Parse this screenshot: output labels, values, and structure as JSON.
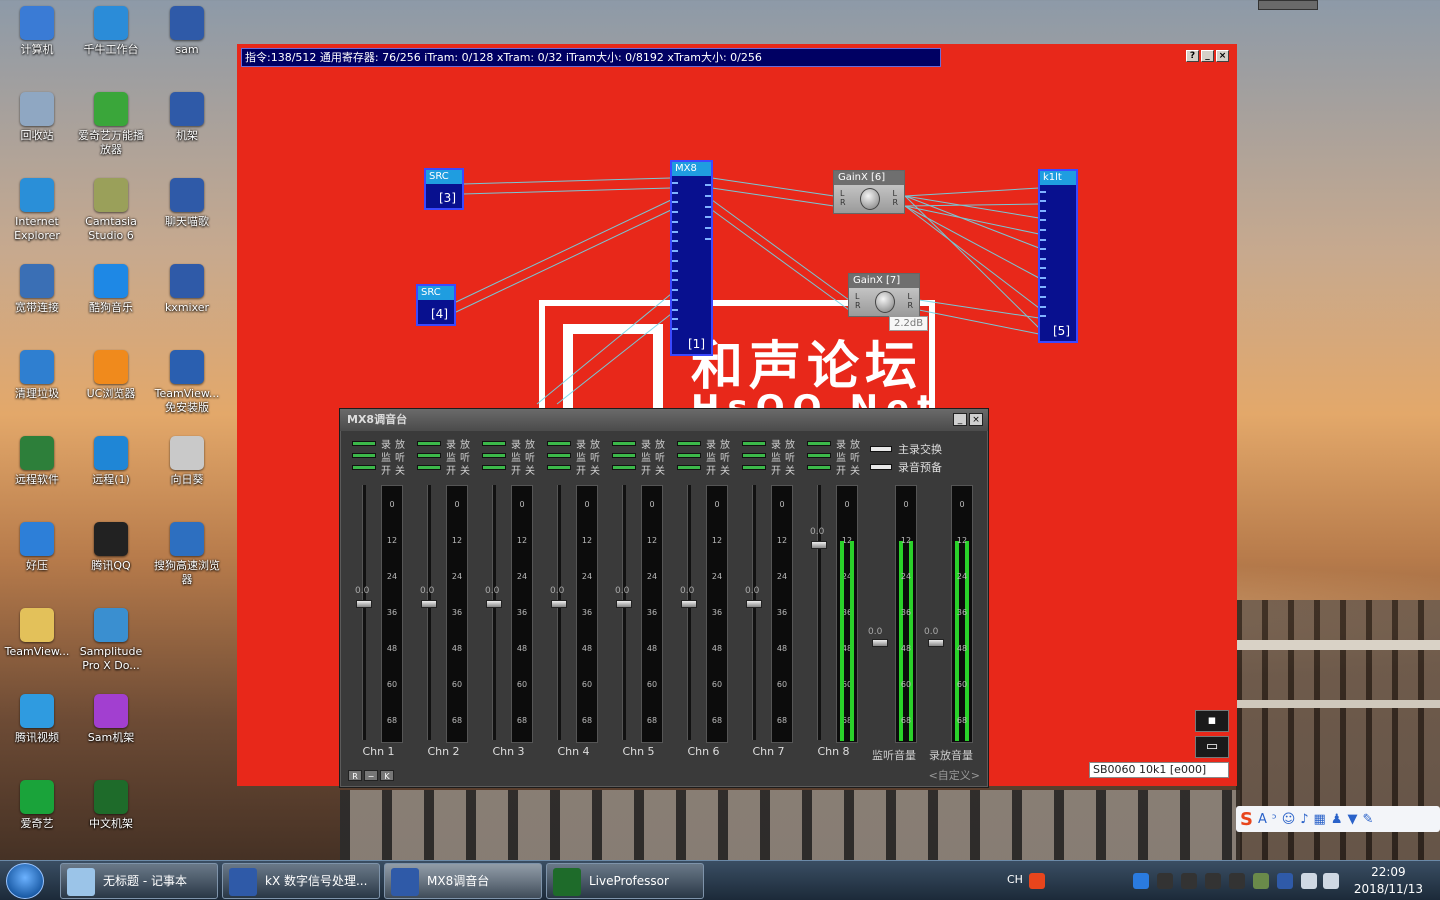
{
  "desktop": {
    "icons": [
      {
        "label": "计算机",
        "icon": "computer-icon",
        "color": "#3a7bd5"
      },
      {
        "label": "千牛工作台",
        "icon": "qianniu-icon",
        "color": "#2b8cd8"
      },
      {
        "label": "sam",
        "icon": "kx-icon",
        "color": "#2f5aa8"
      },
      {
        "label": "回收站",
        "icon": "recycle-bin-icon",
        "color": "#8fa7c2"
      },
      {
        "label": "爱奇艺万能播放器",
        "icon": "iqiyi-player-icon",
        "color": "#3aa63a"
      },
      {
        "label": "机架",
        "icon": "kx-icon",
        "color": "#2f5aa8"
      },
      {
        "label": "Internet Explorer",
        "icon": "ie-icon",
        "color": "#2a8fd8"
      },
      {
        "label": "Camtasia Studio 6",
        "icon": "camtasia-icon",
        "color": "#9aa05a"
      },
      {
        "label": "聊天喵歌",
        "icon": "kx-icon",
        "color": "#2f5aa8"
      },
      {
        "label": "宽带连接",
        "icon": "network-icon",
        "color": "#3a6fb5"
      },
      {
        "label": "酷狗音乐",
        "icon": "kugou-icon",
        "color": "#1e88e5"
      },
      {
        "label": "kxmixer",
        "icon": "kx-icon",
        "color": "#2f5aa8"
      },
      {
        "label": "清理垃圾",
        "icon": "cleaner-icon",
        "color": "#2f7fd0"
      },
      {
        "label": "UC浏览器",
        "icon": "uc-browser-icon",
        "color": "#f08a1c"
      },
      {
        "label": "TeamView...免安装版",
        "icon": "teamviewer-icon",
        "color": "#2a5fb0"
      },
      {
        "label": "远程软件",
        "icon": "folder-icon",
        "color": "#2d7f3a"
      },
      {
        "label": "远程(1)",
        "icon": "remote-icon",
        "color": "#1f86d6"
      },
      {
        "label": "向日葵",
        "icon": "document-icon",
        "color": "#c9c9c9"
      },
      {
        "label": "好压",
        "icon": "haozip-icon",
        "color": "#2d7fd8"
      },
      {
        "label": "腾讯QQ",
        "icon": "qq-icon",
        "color": "#222222"
      },
      {
        "label": "搜狗高速浏览器",
        "icon": "sogou-browser-icon",
        "color": "#2d6fc0"
      },
      {
        "label": "TeamView...",
        "icon": "folder-icon",
        "color": "#e3c15a"
      },
      {
        "label": "Samplitude Pro X Do...",
        "icon": "samplitude-icon",
        "color": "#3a8fd0"
      },
      {
        "label": "腾讯视频",
        "icon": "tencent-video-icon",
        "color": "#2f9be0"
      },
      {
        "label": "Sam机架",
        "icon": "sam-rack-icon",
        "color": "#a23fd0"
      },
      {
        "label": "爱奇艺",
        "icon": "iqiyi-icon",
        "color": "#1aa33a"
      },
      {
        "label": "中文机架",
        "icon": "liveprofessor-icon",
        "color": "#1e6b2a"
      }
    ]
  },
  "dsp": {
    "title": "指令:138/512 通用寄存器: 76/256 iTram: 0/128 xTram: 0/32 iTram大小: 0/8192 xTram大小: 0/256",
    "blocks": {
      "src3": {
        "name": "SRC",
        "index": "[3]"
      },
      "src4": {
        "name": "SRC",
        "index": "[4]"
      },
      "mx8": {
        "name": "MX8",
        "index": "[1]"
      },
      "k1lt": {
        "name": "k1lt",
        "index": "[5]"
      },
      "gain6": {
        "name": "GainX [6]"
      },
      "gain7": {
        "name": "GainX [7]"
      },
      "gain7_tooltip": "2.2dB"
    },
    "logo": {
      "text": "和声论坛",
      "sub": "HsOO.Net"
    },
    "device": "SB0060 10k1 [e000]",
    "win_buttons": [
      "?",
      "_",
      "×"
    ]
  },
  "mixer": {
    "title": "MX8调音台",
    "routing_labels": [
      "录",
      "放",
      "监",
      "听",
      "开",
      "关"
    ],
    "channels": [
      {
        "name": "Chn 1",
        "fader_db": "0.0",
        "fader_level": 0.55
      },
      {
        "name": "Chn 2",
        "fader_db": "0.0",
        "fader_level": 0.55
      },
      {
        "name": "Chn 3",
        "fader_db": "0.0",
        "fader_level": 0.55
      },
      {
        "name": "Chn 4",
        "fader_db": "0.0",
        "fader_level": 0.55
      },
      {
        "name": "Chn 5",
        "fader_db": "0.0",
        "fader_level": 0.55
      },
      {
        "name": "Chn 6",
        "fader_db": "0.0",
        "fader_level": 0.55
      },
      {
        "name": "Chn 7",
        "fader_db": "0.0",
        "fader_level": 0.55
      },
      {
        "name": "Chn 8",
        "fader_db": "0.0",
        "fader_level": 0.78
      }
    ],
    "meter_marks": [
      "0",
      "12",
      "24",
      "36",
      "48",
      "60",
      "68"
    ],
    "master_options": [
      "主录交换",
      "录音预备"
    ],
    "monitor_label": "监听音量",
    "record_label": "录放音量",
    "custom_label": "<自定义>",
    "bottom_buttons": [
      "R",
      "−",
      "K"
    ]
  },
  "ime": {
    "label": "S",
    "mode": "A"
  },
  "taskbar": {
    "tasks": [
      {
        "label": "无标题 - 记事本",
        "icon": "notepad-icon"
      },
      {
        "label": "kX 数字信号处理...",
        "icon": "kx-icon"
      },
      {
        "label": "MX8调音台",
        "icon": "kx-icon"
      },
      {
        "label": "LiveProfessor",
        "icon": "liveprofessor-icon"
      }
    ],
    "lang": "CH",
    "time": "22:09",
    "date": "2018/11/13"
  },
  "colors": {
    "dsp_bg": "#e8281a",
    "block": "#08108f",
    "wire": "#6fd7e8",
    "meter_green": "#2ad12a"
  }
}
